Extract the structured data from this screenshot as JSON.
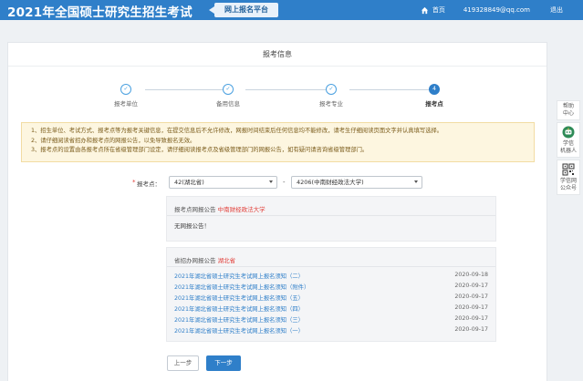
{
  "header": {
    "brand": "2021年全国硕士研究生招生考试",
    "portal": "网上报名平台",
    "home": "首页",
    "email": "419328849@qq.com",
    "logout": "退出"
  },
  "card": {
    "title": "报考信息"
  },
  "steps": [
    {
      "label": "报考单位",
      "state": "done",
      "mark": "✓"
    },
    {
      "label": "备用信息",
      "state": "done",
      "mark": "✓"
    },
    {
      "label": "报考专业",
      "state": "done",
      "mark": "✓"
    },
    {
      "label": "报考点",
      "state": "active",
      "mark": "4"
    }
  ],
  "notice": {
    "lines": [
      "1、招生单位、考试方式、报考点等为报考关键信息，在提交信息后不允许修改，网报时间结束后任何信息均不能修改，请考生仔细阅读页面文字并认真填写选择。",
      "2、请仔细阅读省招办和报考点的网报公告，以免导致报名无效。",
      "3、报考点的设置由各报考点所在省级管理部门设定，请仔细阅读报考点及省级管理部门的网报公告，如有疑问请咨询省级管理部门。"
    ]
  },
  "form": {
    "required_mark": "*",
    "label": "报考点：",
    "province_value": "42(湖北省)",
    "separator": "-",
    "site_value": "4206(中南财经政法大学)"
  },
  "announcement": {
    "title_prefix": "报考点网报公告",
    "title_highlight": "中南财经政法大学",
    "body": "无网报公告！"
  },
  "province_notice": {
    "title_prefix": "省招办网报公告",
    "title_highlight": "湖北省",
    "items": [
      {
        "title": "2021年湖北省硕士研究生考试网上报名须知（二）",
        "date": "2020-09-18"
      },
      {
        "title": "2021年湖北省硕士研究生考试网上报名须知（附件）",
        "date": "2020-09-17"
      },
      {
        "title": "2021年湖北省硕士研究生考试网上报名须知（五）",
        "date": "2020-09-17"
      },
      {
        "title": "2021年湖北省硕士研究生考试网上报名须知（四）",
        "date": "2020-09-17"
      },
      {
        "title": "2021年湖北省硕士研究生考试网上报名须知（三）",
        "date": "2020-09-17"
      },
      {
        "title": "2021年湖北省硕士研究生考试网上报名须知（一）",
        "date": "2020-09-17"
      }
    ]
  },
  "buttons": {
    "prev": "上一步",
    "next": "下一步"
  },
  "side_tools": [
    {
      "label1": "帮助",
      "label2": "中心",
      "icon": "none"
    },
    {
      "label1": "学信",
      "label2": "机器人",
      "icon": "robot-icon"
    },
    {
      "label1": "学信网",
      "label2": "公众号",
      "icon": "qr-code-icon"
    }
  ],
  "colors": {
    "primary": "#2f7fc9",
    "highlight": "#e2423c",
    "notice_bg": "#fdf6e0"
  }
}
